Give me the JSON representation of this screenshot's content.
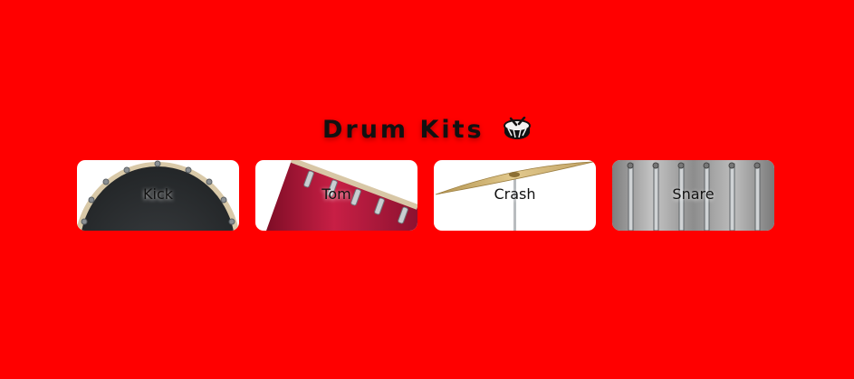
{
  "header": {
    "title": "Drum Kits",
    "icon": "drum-icon"
  },
  "pads": [
    {
      "label": "Kick",
      "icon": "kick-drum-icon"
    },
    {
      "label": "Tom",
      "icon": "tom-drum-icon"
    },
    {
      "label": "Crash",
      "icon": "crash-cymbal-icon"
    },
    {
      "label": "Snare",
      "icon": "snare-drum-icon"
    }
  ],
  "colors": {
    "background": "#ff0000",
    "pad_background": "#ffffff",
    "title_text": "#111111",
    "kick_head": "#2e3133",
    "tom_shell": "#b8173a",
    "crash_cymbal": "#c9ad72",
    "snare_shell": "#9a9a9a"
  }
}
